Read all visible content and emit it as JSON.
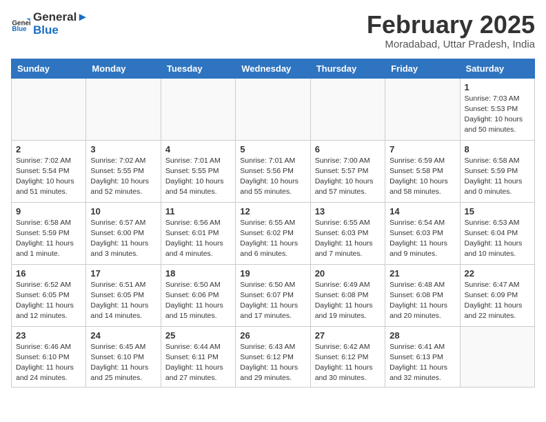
{
  "header": {
    "logo_general": "General",
    "logo_blue": "Blue",
    "month_title": "February 2025",
    "subtitle": "Moradabad, Uttar Pradesh, India"
  },
  "weekdays": [
    "Sunday",
    "Monday",
    "Tuesday",
    "Wednesday",
    "Thursday",
    "Friday",
    "Saturday"
  ],
  "weeks": [
    [
      {
        "day": "",
        "info": ""
      },
      {
        "day": "",
        "info": ""
      },
      {
        "day": "",
        "info": ""
      },
      {
        "day": "",
        "info": ""
      },
      {
        "day": "",
        "info": ""
      },
      {
        "day": "",
        "info": ""
      },
      {
        "day": "1",
        "info": "Sunrise: 7:03 AM\nSunset: 5:53 PM\nDaylight: 10 hours\nand 50 minutes."
      }
    ],
    [
      {
        "day": "2",
        "info": "Sunrise: 7:02 AM\nSunset: 5:54 PM\nDaylight: 10 hours\nand 51 minutes."
      },
      {
        "day": "3",
        "info": "Sunrise: 7:02 AM\nSunset: 5:55 PM\nDaylight: 10 hours\nand 52 minutes."
      },
      {
        "day": "4",
        "info": "Sunrise: 7:01 AM\nSunset: 5:55 PM\nDaylight: 10 hours\nand 54 minutes."
      },
      {
        "day": "5",
        "info": "Sunrise: 7:01 AM\nSunset: 5:56 PM\nDaylight: 10 hours\nand 55 minutes."
      },
      {
        "day": "6",
        "info": "Sunrise: 7:00 AM\nSunset: 5:57 PM\nDaylight: 10 hours\nand 57 minutes."
      },
      {
        "day": "7",
        "info": "Sunrise: 6:59 AM\nSunset: 5:58 PM\nDaylight: 10 hours\nand 58 minutes."
      },
      {
        "day": "8",
        "info": "Sunrise: 6:58 AM\nSunset: 5:59 PM\nDaylight: 11 hours\nand 0 minutes."
      }
    ],
    [
      {
        "day": "9",
        "info": "Sunrise: 6:58 AM\nSunset: 5:59 PM\nDaylight: 11 hours\nand 1 minute."
      },
      {
        "day": "10",
        "info": "Sunrise: 6:57 AM\nSunset: 6:00 PM\nDaylight: 11 hours\nand 3 minutes."
      },
      {
        "day": "11",
        "info": "Sunrise: 6:56 AM\nSunset: 6:01 PM\nDaylight: 11 hours\nand 4 minutes."
      },
      {
        "day": "12",
        "info": "Sunrise: 6:55 AM\nSunset: 6:02 PM\nDaylight: 11 hours\nand 6 minutes."
      },
      {
        "day": "13",
        "info": "Sunrise: 6:55 AM\nSunset: 6:03 PM\nDaylight: 11 hours\nand 7 minutes."
      },
      {
        "day": "14",
        "info": "Sunrise: 6:54 AM\nSunset: 6:03 PM\nDaylight: 11 hours\nand 9 minutes."
      },
      {
        "day": "15",
        "info": "Sunrise: 6:53 AM\nSunset: 6:04 PM\nDaylight: 11 hours\nand 10 minutes."
      }
    ],
    [
      {
        "day": "16",
        "info": "Sunrise: 6:52 AM\nSunset: 6:05 PM\nDaylight: 11 hours\nand 12 minutes."
      },
      {
        "day": "17",
        "info": "Sunrise: 6:51 AM\nSunset: 6:05 PM\nDaylight: 11 hours\nand 14 minutes."
      },
      {
        "day": "18",
        "info": "Sunrise: 6:50 AM\nSunset: 6:06 PM\nDaylight: 11 hours\nand 15 minutes."
      },
      {
        "day": "19",
        "info": "Sunrise: 6:50 AM\nSunset: 6:07 PM\nDaylight: 11 hours\nand 17 minutes."
      },
      {
        "day": "20",
        "info": "Sunrise: 6:49 AM\nSunset: 6:08 PM\nDaylight: 11 hours\nand 19 minutes."
      },
      {
        "day": "21",
        "info": "Sunrise: 6:48 AM\nSunset: 6:08 PM\nDaylight: 11 hours\nand 20 minutes."
      },
      {
        "day": "22",
        "info": "Sunrise: 6:47 AM\nSunset: 6:09 PM\nDaylight: 11 hours\nand 22 minutes."
      }
    ],
    [
      {
        "day": "23",
        "info": "Sunrise: 6:46 AM\nSunset: 6:10 PM\nDaylight: 11 hours\nand 24 minutes."
      },
      {
        "day": "24",
        "info": "Sunrise: 6:45 AM\nSunset: 6:10 PM\nDaylight: 11 hours\nand 25 minutes."
      },
      {
        "day": "25",
        "info": "Sunrise: 6:44 AM\nSunset: 6:11 PM\nDaylight: 11 hours\nand 27 minutes."
      },
      {
        "day": "26",
        "info": "Sunrise: 6:43 AM\nSunset: 6:12 PM\nDaylight: 11 hours\nand 29 minutes."
      },
      {
        "day": "27",
        "info": "Sunrise: 6:42 AM\nSunset: 6:12 PM\nDaylight: 11 hours\nand 30 minutes."
      },
      {
        "day": "28",
        "info": "Sunrise: 6:41 AM\nSunset: 6:13 PM\nDaylight: 11 hours\nand 32 minutes."
      },
      {
        "day": "",
        "info": ""
      }
    ]
  ]
}
